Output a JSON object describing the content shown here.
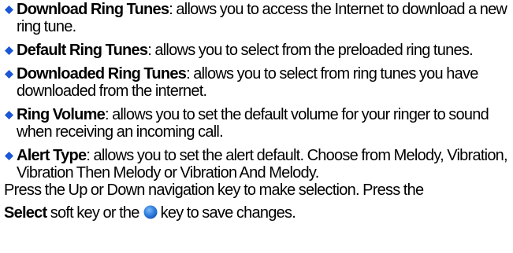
{
  "bullets": [
    {
      "term": "Download Ring Tunes",
      "description": ": allows you to access the Internet to download a new ring tune."
    },
    {
      "term": "Default Ring Tunes",
      "description": ": allows you to select from the preloaded ring tunes."
    },
    {
      "term": "Downloaded Ring Tunes",
      "description": ": allows you to select from ring tunes you have downloaded from the internet."
    },
    {
      "term": "Ring Volume",
      "description": ": allows you to set the default volume for your ringer to sound when receiving an incoming call."
    },
    {
      "term": "Alert Type",
      "description": ": allows you to set the alert default. Choose from Melody, Vibration, Vibration Then Melody or Vibration And Melody."
    }
  ],
  "note": {
    "line1": "Press the Up or Down navigation key to make selection. Press the",
    "select_word": "Select",
    "middle": "soft key or the",
    "end": "key to save changes."
  },
  "icons": {
    "bullet": "blue-diamond-bullet-icon",
    "ok_key": "blue-circle-ok-key-icon"
  },
  "colors": {
    "bullet_blue": "#1a56d6",
    "key_blue": "#2f7fe0"
  }
}
